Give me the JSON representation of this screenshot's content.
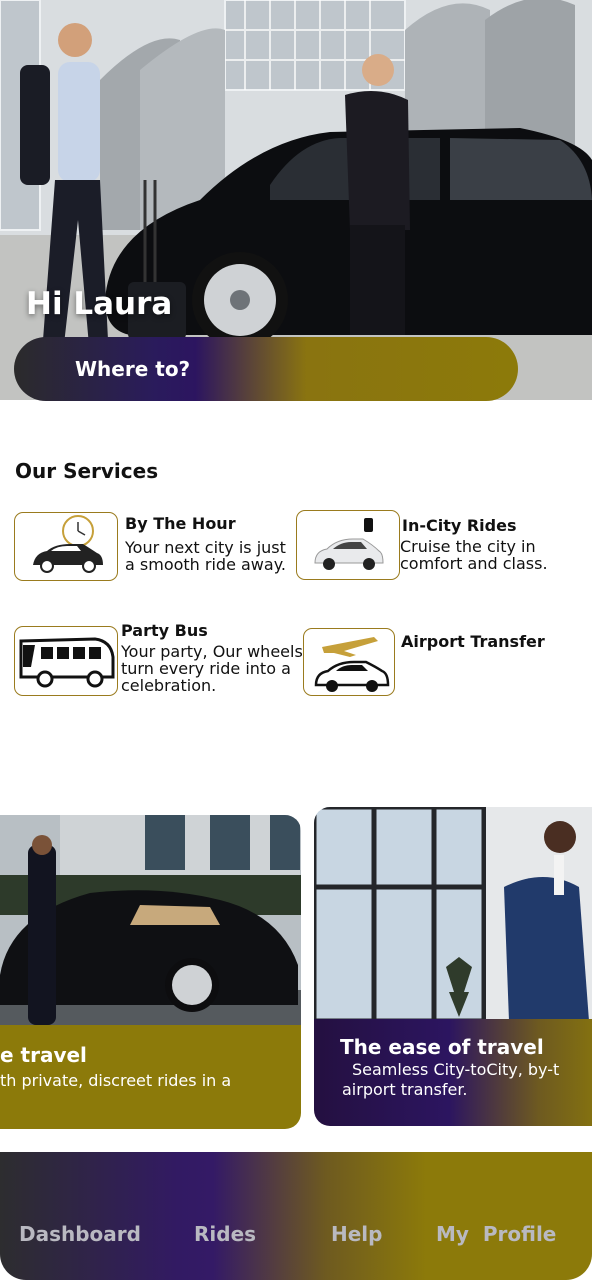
{
  "hero": {
    "greeting": "Hi Laura",
    "search_placeholder": "Where to?"
  },
  "services": {
    "title": "Our Services",
    "items": [
      {
        "title": "By The Hour",
        "description": "Your next city is just a smooth ride away.",
        "icon": "clock-car-icon"
      },
      {
        "title": "In-City Rides",
        "description": "Cruise the city in comfort and class.",
        "icon": "city-car-icon"
      },
      {
        "title": "Party Bus",
        "description": "Your party, Our wheels turn every ride into a celebration.",
        "icon": "bus-icon"
      },
      {
        "title": "Airport Transfer",
        "description": "",
        "icon": "airplane-car-icon"
      }
    ]
  },
  "promos": [
    {
      "title": "e travel",
      "text": "th private, discreet rides in a"
    },
    {
      "title": "The ease of travel",
      "text": "Seamless City-toCity, by-t airport transfer."
    }
  ],
  "nav": {
    "items": [
      "Dashboard",
      "Rides",
      "Help",
      "My  Profile"
    ]
  },
  "colors": {
    "accent_gold": "#8c7a0a",
    "accent_purple": "#2c1560",
    "icon_border": "#9a7b1e"
  }
}
